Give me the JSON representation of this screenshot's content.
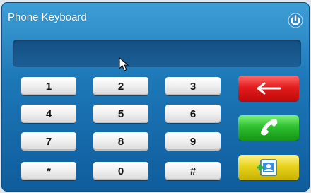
{
  "window": {
    "title": "Phone Keyboard"
  },
  "icons": {
    "power": "power-icon",
    "backspace": "backspace-arrow-icon",
    "call": "phone-handset-icon",
    "contacts": "contacts-book-icon"
  },
  "display": {
    "value": ""
  },
  "keys": [
    "1",
    "2",
    "3",
    "4",
    "5",
    "6",
    "7",
    "8",
    "9",
    "*",
    "0",
    "#"
  ],
  "colors": {
    "accent": "#1d78b8",
    "delete": "#e31d1d",
    "call": "#2fc02f",
    "contacts": "#e7d31e"
  }
}
